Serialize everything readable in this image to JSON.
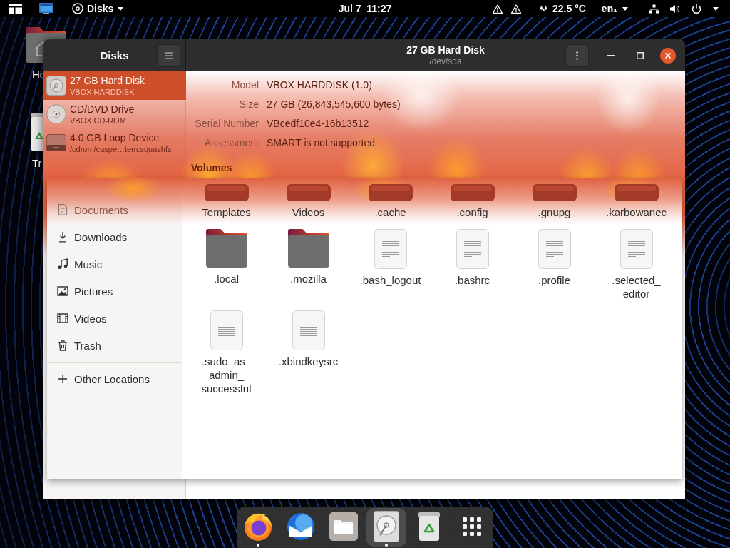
{
  "top_bar": {
    "app_menu": {
      "label": "Disks"
    },
    "clock": "Jul 7  11:27",
    "weather": {
      "temperature": "22.5 °C"
    },
    "keyboard_layout": {
      "label": "en₁"
    }
  },
  "desktop": {
    "icons": [
      {
        "kind": "home",
        "label": "Ho"
      },
      {
        "kind": "trash",
        "label": "Tr"
      }
    ]
  },
  "disks_window": {
    "sidebar_title": "Disks",
    "title": "27 GB Hard Disk",
    "subtitle": "/dev/sda",
    "devices": [
      {
        "kind": "hard_disk",
        "name": "27 GB Hard Disk",
        "detail": "VBOX HARDDISK",
        "selected": true
      },
      {
        "kind": "optical",
        "name": "CD/DVD Drive",
        "detail": "VBOX CD-ROM",
        "selected": false
      },
      {
        "kind": "loop",
        "name": "4.0 GB Loop Device",
        "detail": "/cdrom/caspe…tem.squashfs",
        "selected": false
      }
    ],
    "properties": [
      {
        "label": "Model",
        "value": "VBOX HARDDISK (1.0)"
      },
      {
        "label": "Size",
        "value": "27 GB (26,843,545,600 bytes)"
      },
      {
        "label": "Serial Number",
        "value": "VBcedf10e4-16b13512"
      },
      {
        "label": "Assessment",
        "value": "SMART is not supported"
      }
    ],
    "volumes_heading": "Volumes"
  },
  "files_window": {
    "places": [
      {
        "kind": "documents",
        "label": "Documents",
        "burned": true
      },
      {
        "kind": "downloads",
        "label": "Downloads",
        "burned": false
      },
      {
        "kind": "music",
        "label": "Music",
        "burned": false
      },
      {
        "kind": "pictures",
        "label": "Pictures",
        "burned": false
      },
      {
        "kind": "videos",
        "label": "Videos",
        "burned": false
      },
      {
        "kind": "trash",
        "label": "Trash",
        "burned": false
      }
    ],
    "other_locations": {
      "label": "Other Locations"
    },
    "items": [
      {
        "kind": "folder",
        "name": "Templates",
        "burned": true
      },
      {
        "kind": "folder",
        "name": "Videos",
        "burned": true
      },
      {
        "kind": "folder",
        "name": ".cache",
        "burned": true
      },
      {
        "kind": "folder",
        "name": ".config",
        "burned": true
      },
      {
        "kind": "folder",
        "name": ".gnupg",
        "burned": true
      },
      {
        "kind": "folder",
        "name": ".karbowanec",
        "burned": true
      },
      {
        "kind": "folder",
        "name": ".local",
        "burned": false
      },
      {
        "kind": "folder",
        "name": ".mozilla",
        "burned": false
      },
      {
        "kind": "file",
        "name": ".bash_logout",
        "burned": false
      },
      {
        "kind": "file",
        "name": ".bashrc",
        "burned": false
      },
      {
        "kind": "file",
        "name": ".profile",
        "burned": false
      },
      {
        "kind": "file",
        "name": ".selected_editor",
        "burned": false
      },
      {
        "kind": "file",
        "name": ".sudo_as_admin_successful",
        "burned": false
      },
      {
        "kind": "file",
        "name": ".xbindkeysrc",
        "burned": false
      }
    ]
  },
  "dock": {
    "items": [
      {
        "kind": "browser",
        "running": true,
        "focused": false
      },
      {
        "kind": "mail",
        "running": false,
        "focused": false
      },
      {
        "kind": "files",
        "running": false,
        "focused": false
      },
      {
        "kind": "disks",
        "running": true,
        "focused": true
      },
      {
        "kind": "trash",
        "running": false,
        "focused": false
      },
      {
        "kind": "app_grid",
        "running": false,
        "focused": false
      }
    ]
  }
}
